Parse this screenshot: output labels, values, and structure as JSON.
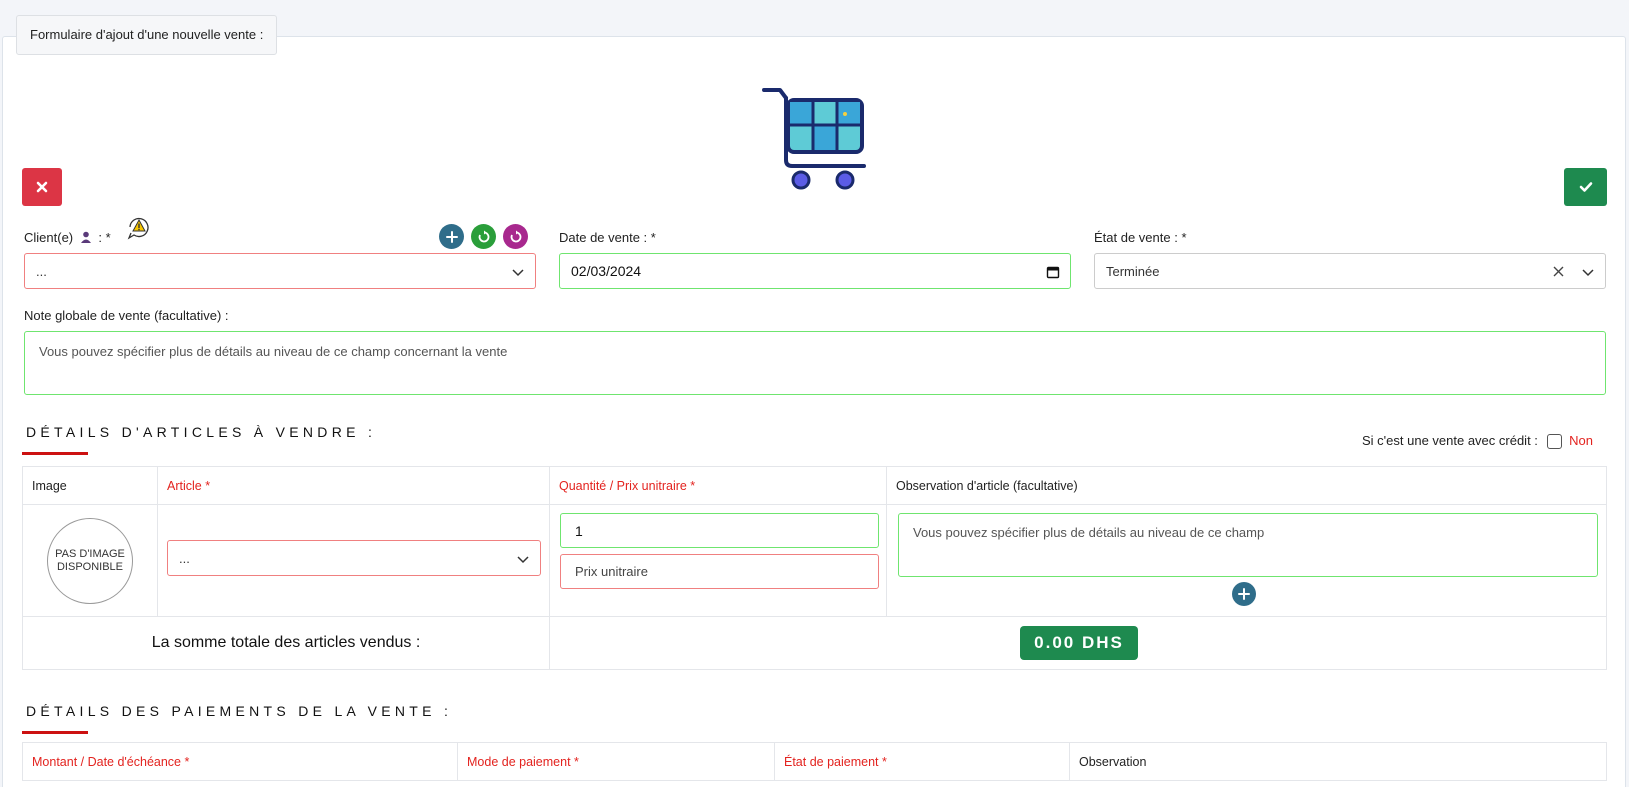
{
  "form": {
    "legend": "Formulaire d'ajout d'une nouvelle vente :",
    "client_label": "Client(e)",
    "client_label_suffix": ": *",
    "client_value": "...",
    "date_label": "Date de vente : *",
    "date_value": "02/03/2024",
    "etat_label": "État de vente : *",
    "etat_value": "Terminée",
    "note_label": "Note globale de vente (facultative) :",
    "note_placeholder": "Vous pouvez spécifier plus de détails au niveau de ce champ concernant la vente"
  },
  "articles": {
    "title": "DÉTAILS D'ARTICLES À VENDRE :",
    "credit_label": "Si c'est une vente avec crédit :",
    "credit_value": "Non",
    "headers": {
      "image": "Image",
      "article": "Article *",
      "quantite": "Quantité / Prix unitraire *",
      "observation": "Observation d'article (facultative)"
    },
    "no_image_line1": "PAS D'IMAGE",
    "no_image_line2": "DISPONIBLE",
    "article_value": "...",
    "quantity_value": "1",
    "prix_placeholder": "Prix unitraire",
    "observation_placeholder": "Vous pouvez spécifier plus de détails au niveau de ce champ",
    "total_label": "La somme totale des articles vendus :",
    "total_value": "0.00 DHS"
  },
  "payments": {
    "title": "DÉTAILS DES PAIEMENTS DE LA VENTE :",
    "headers": {
      "montant": "Montant / Date d'échéance *",
      "mode": "Mode de paiement *",
      "etat": "État de paiement *",
      "observation": "Observation"
    }
  },
  "colors": {
    "danger": "#dc3545",
    "success": "#1e8a4f",
    "required_text": "#e3231f",
    "valid_border": "#6fe56f",
    "invalid_border": "#f08080"
  },
  "icons": [
    "cart-icon",
    "close-icon",
    "check-icon",
    "user-icon",
    "warning-icon",
    "plus-icon",
    "refresh-icon",
    "chevron-down-icon",
    "calendar-icon",
    "clear-icon"
  ]
}
